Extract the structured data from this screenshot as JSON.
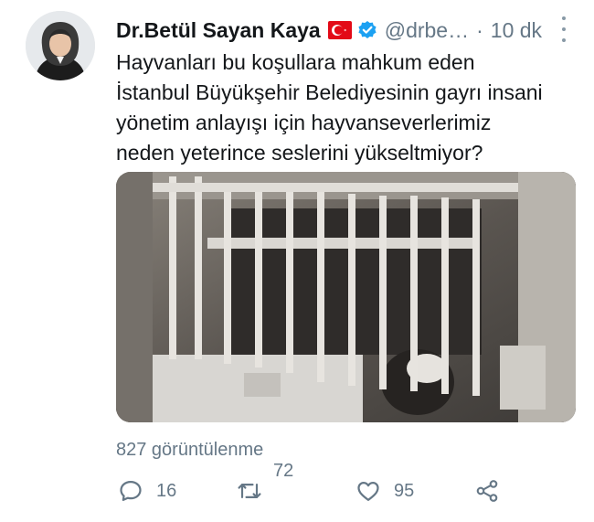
{
  "tweet": {
    "author_name": "Dr.Betül Sayan Kaya",
    "handle": "@drbe…",
    "separator": "·",
    "time": "10 dk",
    "text": "Hayvanları bu koşullara mahkum eden\nİstanbul Büyükşehir Belediyesinin gayrı insani\nyönetim anlayışı için hayvanseverlerimiz\nneden yeterince seslerini yükseltmiyor?",
    "views": "827 görüntülenme",
    "actions": {
      "reply_icon": "reply-icon",
      "reply_count": "16",
      "retweet_icon": "retweet-icon",
      "retweet_count": "72",
      "like_icon": "heart-icon",
      "like_count": "95",
      "share_icon": "share-icon"
    },
    "icons": {
      "flag": "turkey-flag-icon",
      "verified": "verified-badge-icon",
      "menu": "more-options-icon"
    },
    "colors": {
      "text": "#14171a",
      "secondary": "#657786",
      "verified_blue": "#1da1f2",
      "flag_red": "#e30a17"
    }
  }
}
